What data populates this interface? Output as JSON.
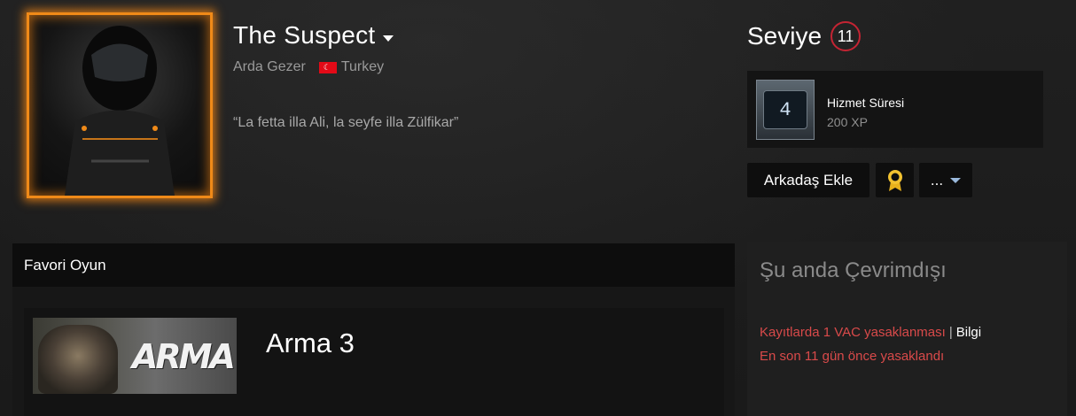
{
  "profile": {
    "persona_name": "The Suspect",
    "real_name": "Arda Gezer",
    "country": "Turkey",
    "summary": "“La fetta illa Ali, la seyfe illa Zülfikar”"
  },
  "level": {
    "label": "Seviye",
    "value": "11",
    "badge_color": "#c42433"
  },
  "badge": {
    "icon_number": "4",
    "name": "Hizmet Süresi",
    "xp": "200 XP"
  },
  "actions": {
    "add_friend": "Arkadaş Ekle",
    "more": "..."
  },
  "favorite": {
    "header": "Favori Oyun",
    "game_title": "Arma 3",
    "game_logo": "ARMA"
  },
  "status": {
    "title": "Şu anda Çevrimdışı",
    "vac_text": "Kayıtlarda 1 VAC yasaklanması",
    "vac_separator": "|",
    "vac_info": "Bilgi",
    "last_ban": "En son 11 gün önce yasaklandı"
  },
  "colors": {
    "avatar_frame": "#f08a18",
    "vac_red": "#d94a4a",
    "background": "#1b1b1b"
  }
}
